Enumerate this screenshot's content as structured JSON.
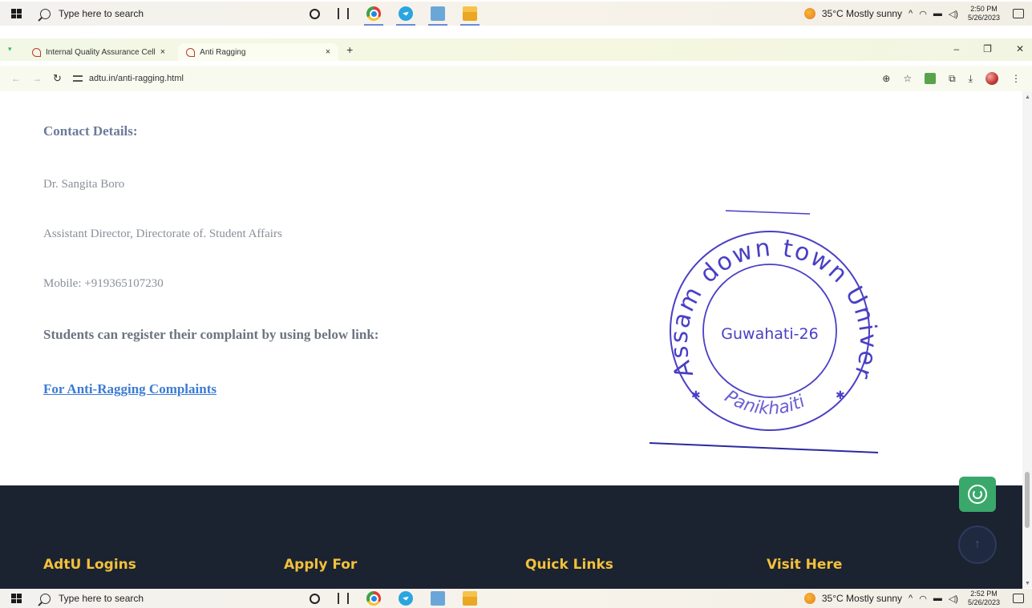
{
  "taskbar_top": {
    "search_placeholder": "Type here to search",
    "weather": "35°C  Mostly sunny",
    "time": "2:50 PM",
    "date": "5/26/2023"
  },
  "taskbar_bottom": {
    "search_placeholder": "Type here to search",
    "weather": "35°C  Mostly sunny",
    "time": "2:52 PM",
    "date": "5/26/2023"
  },
  "browser": {
    "tabs": [
      {
        "label": "Internal Quality Assurance Cell",
        "close": "×"
      },
      {
        "label": "Anti Ragging",
        "close": "×"
      }
    ],
    "new_tab": "+",
    "url": "adtu.in/anti-ragging.html"
  },
  "content": {
    "heading": "Contact Details:",
    "name": "Dr. Sangita Boro",
    "designation": "Assistant Director, Directorate of. Student Affairs",
    "mobile": "Mobile: +919365107230",
    "register_text": "Students can register their complaint by using below link:",
    "link_label": "For Anti-Ragging Complaints"
  },
  "seal": {
    "outer_text": "Assam down town University",
    "inner_text": "Guwahati-26",
    "bottom_text": "Panikhaiti",
    "ink_color": "#4a3fc4"
  },
  "footer": {
    "columns": [
      "AdtU Logins",
      "Apply For",
      "Quick Links",
      "Visit Here"
    ]
  },
  "colors": {
    "footer_bg": "#1b2230",
    "footer_heading": "#f2c13b",
    "link": "#3b7bd4",
    "whatsapp": "#3aa86b"
  }
}
